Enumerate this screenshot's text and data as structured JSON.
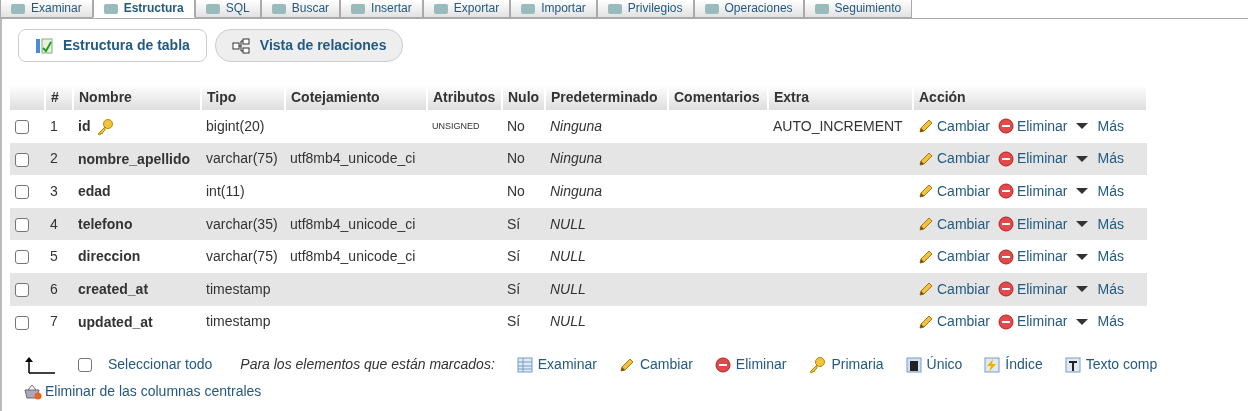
{
  "tabs": [
    {
      "label": "Examinar",
      "selected": false
    },
    {
      "label": "Estructura",
      "selected": true
    },
    {
      "label": "SQL",
      "selected": false
    },
    {
      "label": "Buscar",
      "selected": false
    },
    {
      "label": "Insertar",
      "selected": false
    },
    {
      "label": "Exportar",
      "selected": false
    },
    {
      "label": "Importar",
      "selected": false
    },
    {
      "label": "Privilegios",
      "selected": false
    },
    {
      "label": "Operaciones",
      "selected": false
    },
    {
      "label": "Seguimiento",
      "selected": false
    }
  ],
  "subnav": [
    {
      "label": "Estructura de tabla",
      "selected": true
    },
    {
      "label": "Vista de relaciones",
      "selected": false
    }
  ],
  "table": {
    "columns": [
      "#",
      "Nombre",
      "Tipo",
      "Cotejamiento",
      "Atributos",
      "Nulo",
      "Predeterminado",
      "Comentarios",
      "Extra",
      "Acción"
    ],
    "rows": [
      {
        "checked": false,
        "number": "1",
        "name": "id",
        "primary": true,
        "type": "bigint(20)",
        "collation": "",
        "attributes": "UNSIGNED",
        "null": "No",
        "default": "Ninguna",
        "extra": "AUTO_INCREMENT",
        "actions": [
          "Cambiar",
          "Eliminar",
          "Más"
        ]
      },
      {
        "checked": false,
        "number": "2",
        "name": "nombre_apellido",
        "primary": false,
        "type": "varchar(75)",
        "collation": "utf8mb4_unicode_ci",
        "attributes": "",
        "null": "No",
        "default": "Ninguna",
        "extra": "",
        "actions": [
          "Cambiar",
          "Eliminar",
          "Más"
        ]
      },
      {
        "checked": false,
        "number": "3",
        "name": "edad",
        "primary": false,
        "type": "int(11)",
        "collation": "",
        "attributes": "",
        "null": "No",
        "default": "Ninguna",
        "extra": "",
        "actions": [
          "Cambiar",
          "Eliminar",
          "Más"
        ]
      },
      {
        "checked": false,
        "number": "4",
        "name": "telefono",
        "primary": false,
        "type": "varchar(35)",
        "collation": "utf8mb4_unicode_ci",
        "attributes": "",
        "null": "Sí",
        "default": "NULL",
        "extra": "",
        "actions": [
          "Cambiar",
          "Eliminar",
          "Más"
        ]
      },
      {
        "checked": false,
        "number": "5",
        "name": "direccion",
        "primary": false,
        "type": "varchar(75)",
        "collation": "utf8mb4_unicode_ci",
        "attributes": "",
        "null": "Sí",
        "default": "NULL",
        "extra": "",
        "actions": [
          "Cambiar",
          "Eliminar",
          "Más"
        ]
      },
      {
        "checked": false,
        "number": "6",
        "name": "created_at",
        "primary": false,
        "type": "timestamp",
        "collation": "",
        "attributes": "",
        "null": "Sí",
        "default": "NULL",
        "extra": "",
        "actions": [
          "Cambiar",
          "Eliminar",
          "Más"
        ]
      },
      {
        "checked": false,
        "number": "7",
        "name": "updated_at",
        "primary": false,
        "type": "timestamp",
        "collation": "",
        "attributes": "",
        "null": "Sí",
        "default": "NULL",
        "extra": "",
        "actions": [
          "Cambiar",
          "Eliminar",
          "Más"
        ]
      }
    ]
  },
  "footer": {
    "select_all": {
      "label": "Seleccionar todo",
      "checked": false
    },
    "marked_label": "Para los elementos que están marcados:",
    "bulk_actions": [
      "Examinar",
      "Cambiar",
      "Eliminar",
      "Primaria",
      "Único",
      "Índice",
      "Texto comp"
    ],
    "central_action": "Eliminar de las columnas centrales"
  }
}
